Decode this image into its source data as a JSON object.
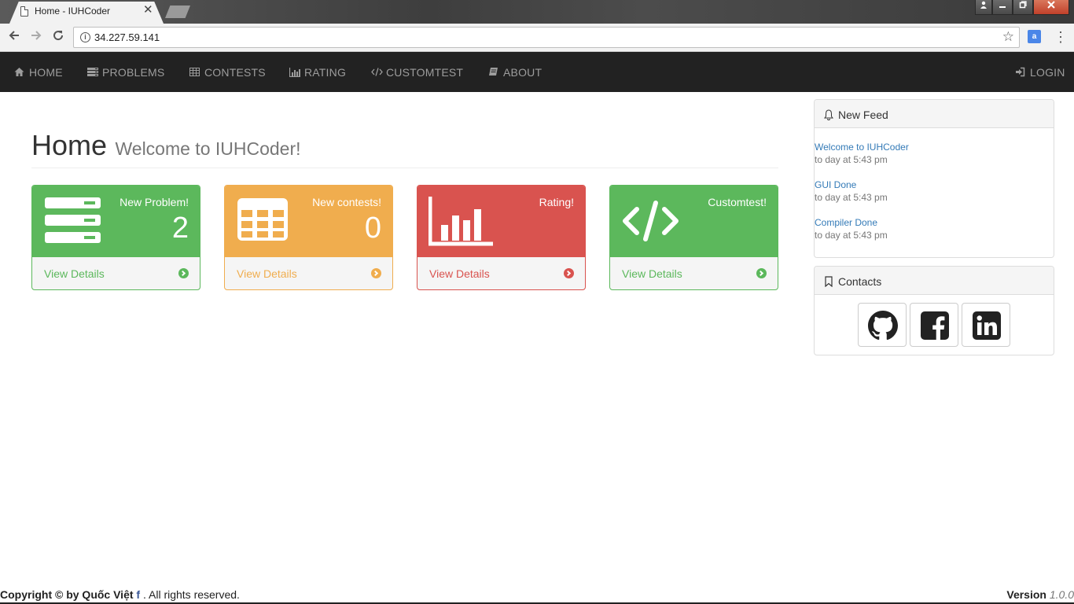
{
  "browser": {
    "tab_title": "Home - IUHCoder",
    "tab_close": "✕",
    "url": "34.227.59.141",
    "info_symbol": "i",
    "translate_symbol": "a"
  },
  "navbar": {
    "items": [
      {
        "label": "HOME",
        "icon": "home-icon"
      },
      {
        "label": "PROBLEMS",
        "icon": "list-icon"
      },
      {
        "label": "CONTESTS",
        "icon": "table-icon"
      },
      {
        "label": "RATING",
        "icon": "bar-chart-icon"
      },
      {
        "label": "CUSTOMTEST",
        "icon": "code-icon"
      },
      {
        "label": "ABOUT",
        "icon": "book-icon"
      }
    ],
    "login": "LOGIN"
  },
  "header": {
    "title": "Home",
    "subtitle": "Welcome to IUHCoder!"
  },
  "panels": [
    {
      "caption": "New Problem!",
      "count": "2",
      "link": "View Details",
      "color": "#5cb85c",
      "icon": "server-icon"
    },
    {
      "caption": "New contests!",
      "count": "0",
      "link": "View Details",
      "color": "#f0ad4e",
      "icon": "table-icon"
    },
    {
      "caption": "Rating!",
      "count": "",
      "link": "View Details",
      "color": "#d9534f",
      "icon": "bar-chart-icon"
    },
    {
      "caption": "Customtest!",
      "count": "",
      "link": "View Details",
      "color": "#5cb85c",
      "icon": "code-icon"
    }
  ],
  "feed": {
    "title": "New Feed",
    "items": [
      {
        "title": "Welcome to IUHCoder",
        "time": "to day at 5:43 pm"
      },
      {
        "title": "GUI Done",
        "time": "to day at 5:43 pm"
      },
      {
        "title": "Compiler Done",
        "time": "to day at 5:43 pm"
      }
    ]
  },
  "contacts": {
    "title": "Contacts",
    "links": [
      "github-icon",
      "facebook-icon",
      "linkedin-icon"
    ]
  },
  "footer": {
    "copyright_prefix": "Copyright © by Quốc Việt",
    "fb_glyph": "f",
    "rights": ". All rights reserved.",
    "version_label": "Version",
    "version_number": "1.0.0"
  }
}
